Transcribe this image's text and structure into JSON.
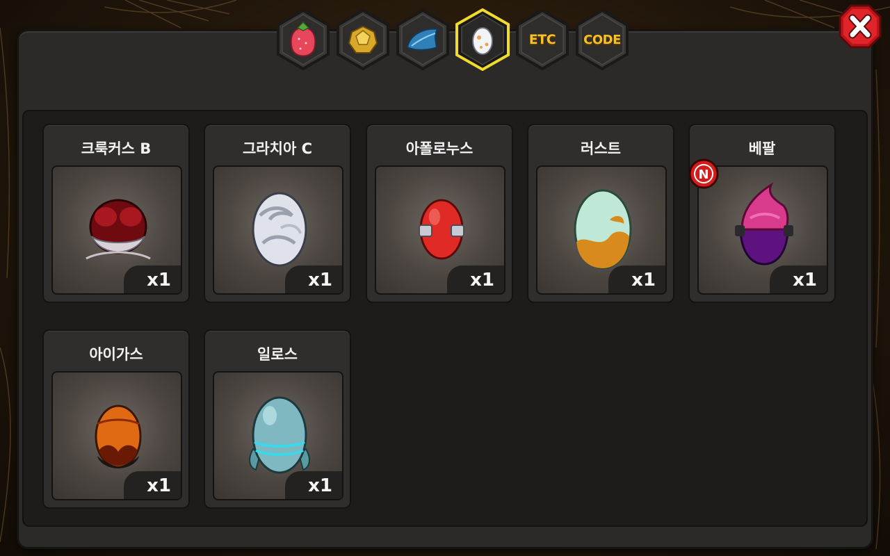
{
  "tabs": [
    {
      "name": "fruit",
      "icon": "strawberry-icon",
      "text": "",
      "active": false
    },
    {
      "name": "material",
      "icon": "gold-ore-icon",
      "text": "",
      "active": false
    },
    {
      "name": "feather",
      "icon": "blue-feather-icon",
      "text": "",
      "active": false
    },
    {
      "name": "egg",
      "icon": "egg-icon",
      "text": "",
      "active": true
    },
    {
      "name": "etc",
      "icon": "",
      "text": "ETC",
      "active": false
    },
    {
      "name": "code",
      "icon": "",
      "text": "CODE",
      "active": false
    }
  ],
  "items": [
    {
      "name": "크룩커스 B",
      "count": "x1",
      "egg": "crukus-egg",
      "new": false
    },
    {
      "name": "그라치아 C",
      "count": "x1",
      "egg": "grachia-egg",
      "new": false
    },
    {
      "name": "아폴로누스",
      "count": "x1",
      "egg": "apollonus-egg",
      "new": false
    },
    {
      "name": "러스트",
      "count": "x1",
      "egg": "rust-egg",
      "new": false
    },
    {
      "name": "베팔",
      "count": "x1",
      "egg": "bepal-egg",
      "new": true,
      "badge": "N"
    },
    {
      "name": "아이가스",
      "count": "x1",
      "egg": "aigas-egg",
      "new": false
    },
    {
      "name": "일로스",
      "count": "x1",
      "egg": "ilos-egg",
      "new": false
    }
  ],
  "colors": {
    "accent": "#f6c22a",
    "close": "#d81e1e",
    "panel": "#2b2a28"
  }
}
